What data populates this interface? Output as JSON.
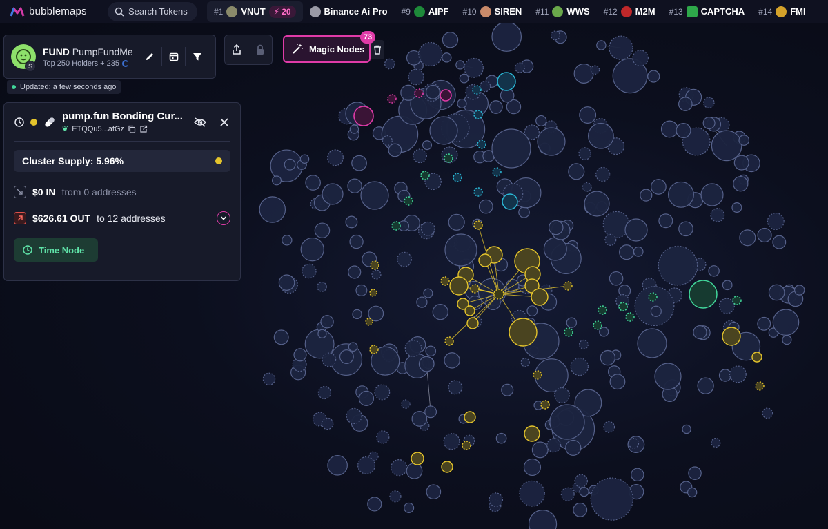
{
  "app": {
    "name": "bubblemaps"
  },
  "search": {
    "placeholder": "Search Tokens"
  },
  "trending": [
    {
      "rank": "#1",
      "name": "VNUT",
      "boost": "20",
      "icon_color": "#8a8a6a"
    },
    {
      "rank": "",
      "name": "Binance Ai Pro",
      "icon_color": "#9a9aa6"
    },
    {
      "rank": "#9",
      "name": "AIPF",
      "icon_color": "#1e8a3a"
    },
    {
      "rank": "#10",
      "name": "SIREN",
      "icon_color": "#c98a6a"
    },
    {
      "rank": "#11",
      "name": "WWS",
      "icon_color": "#6aa84a"
    },
    {
      "rank": "#12",
      "name": "M2M",
      "icon_color": "#c0282a"
    },
    {
      "rank": "#13",
      "name": "CAPTCHA",
      "icon_color": "#2ea84a"
    },
    {
      "rank": "#14",
      "name": "FMI",
      "icon_color": "#d4a22a"
    }
  ],
  "token": {
    "symbol": "FUND",
    "name": "PumpFundMe",
    "holders": "Top 250 Holders + 235",
    "chain_letter": "S"
  },
  "status": {
    "updated": "Updated: a few seconds ago"
  },
  "magic": {
    "label": "Magic Nodes",
    "count": "73"
  },
  "cluster": {
    "title": "pump.fun Bonding Cur...",
    "address": "ETQQu5...afGz",
    "supply": "Cluster Supply: 5.96%",
    "in_amount": "$0 IN",
    "in_detail": "from 0 addresses",
    "out_amount": "$626.61 OUT",
    "out_detail": "to 12 addresses",
    "time_node": "Time Node"
  },
  "colors": {
    "accent": "#e03ba8",
    "cluster_yellow": "#e4c42c",
    "green": "#41d79a",
    "bubble": "#1c2440"
  }
}
